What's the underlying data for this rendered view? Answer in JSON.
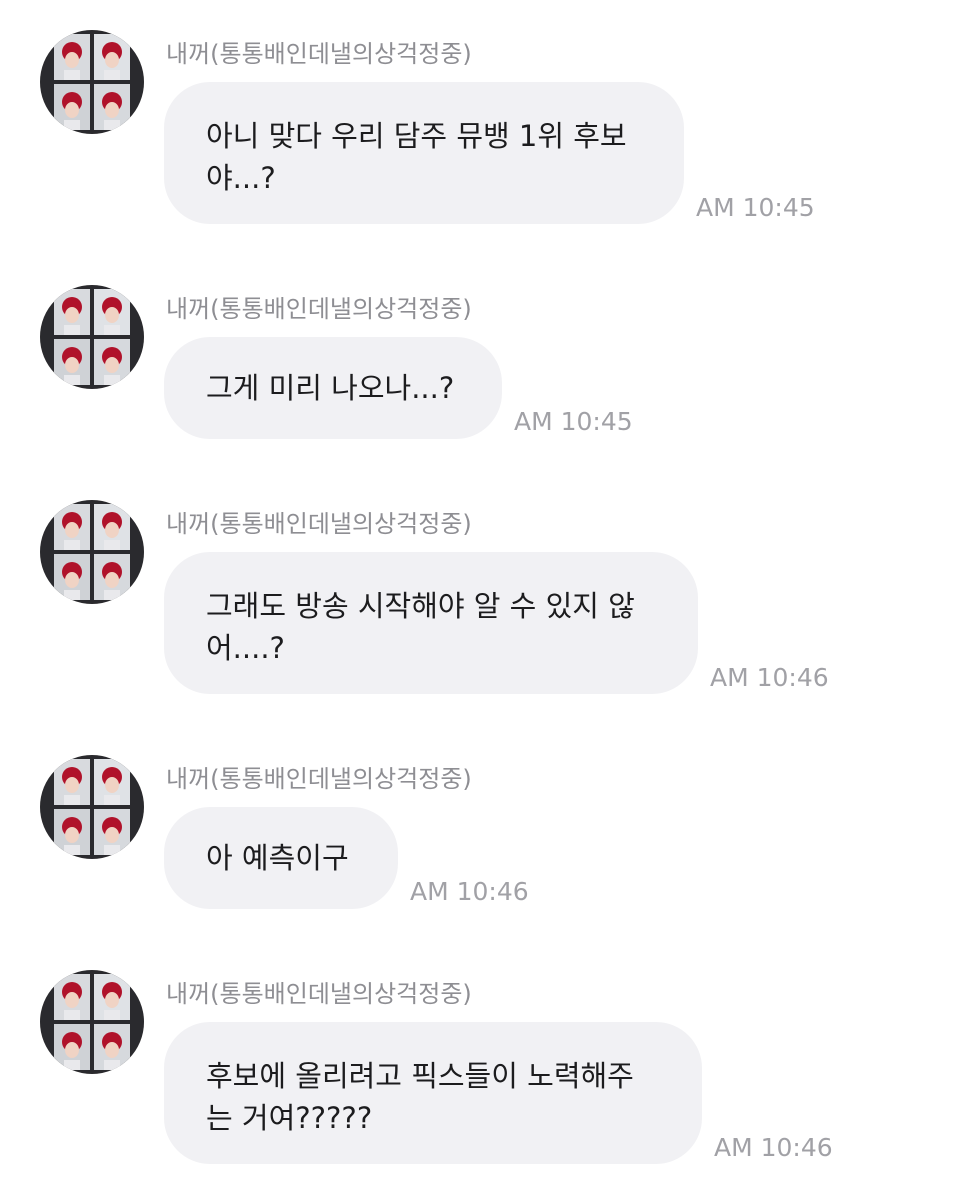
{
  "chat": {
    "messages": [
      {
        "sender": "내꺼(통통배인데낼의상걱정중)",
        "text": "아니 맞다 우리 담주 뮤뱅 1위 후보\n야...?",
        "time": "AM 10:45",
        "avatar_icon": "profile-photo-grid"
      },
      {
        "sender": "내꺼(통통배인데낼의상걱정중)",
        "text": "그게 미리 나오나...?",
        "time": "AM 10:45",
        "avatar_icon": "profile-photo-grid"
      },
      {
        "sender": "내꺼(통통배인데낼의상걱정중)",
        "text": "그래도 방송 시작해야 알 수 있지 않\n어....?",
        "time": "AM 10:46",
        "avatar_icon": "profile-photo-grid"
      },
      {
        "sender": "내꺼(통통배인데낼의상걱정중)",
        "text": "아 예측이구",
        "time": "AM 10:46",
        "avatar_icon": "profile-photo-grid"
      },
      {
        "sender": "내꺼(통통배인데낼의상걱정중)",
        "text": "후보에 올리려고 픽스들이 노력해주\n는 거여?????",
        "time": "AM 10:46",
        "avatar_icon": "profile-photo-grid"
      }
    ]
  },
  "colors": {
    "bubble": "#f1f1f4",
    "sender_text": "#8e8e93",
    "time_text": "#a1a1a6",
    "message_text": "#1c1c1e",
    "avatar_hair": "#b0122a"
  }
}
